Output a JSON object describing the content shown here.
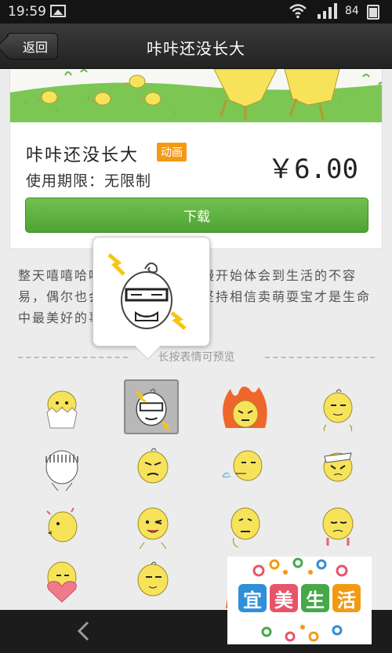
{
  "status_bar": {
    "time": "19:59",
    "battery": "84"
  },
  "header": {
    "back_label": "返回",
    "title": "咔咔还没长大"
  },
  "product": {
    "name": "咔咔还没长大",
    "badge": "动画",
    "period": "使用期限：无限制",
    "price": "￥6.00",
    "download_label": "下载"
  },
  "description": "整天嘻嘻哈哈的咔咔，突然慢慢开始体会到生活的不容易，偶尔也会叹气，不过还是坚持相信卖萌耍宝才是生命中最美好的事！",
  "divider_label": "长按表情可预览",
  "watermark": {
    "chars": [
      "宜",
      "美",
      "生",
      "活"
    ],
    "colors": [
      "#2f8fd8",
      "#e8546a",
      "#47a84a",
      "#f29a14"
    ]
  },
  "colors": {
    "accent_green": "#5cb33e",
    "badge_orange": "#f29a14",
    "chick_yellow": "#f7e35a"
  },
  "icons": [
    "wifi-icon",
    "signal-icon",
    "battery-icon",
    "gallery-icon",
    "back-arrow-icon"
  ]
}
